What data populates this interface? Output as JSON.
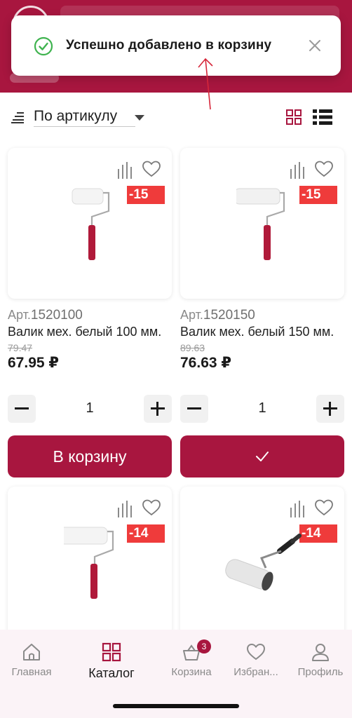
{
  "toast": {
    "message": "Успешно добавлено в корзину"
  },
  "sort": {
    "label": "По артикулу"
  },
  "colors": {
    "brand": "#a8163f",
    "discount": "#ef3b3b",
    "success": "#3fb34f"
  },
  "products": [
    {
      "sku_prefix": "Арт.",
      "sku": "1520100",
      "name": "Валик мех. белый 100 мм.",
      "old_price": "79.47",
      "price": "67.95 ₽",
      "discount": "-15",
      "qty": "1",
      "cart_label": "В корзину",
      "in_cart": false
    },
    {
      "sku_prefix": "Арт.",
      "sku": "1520150",
      "name": "Валик мех. белый 150 мм.",
      "old_price": "89.63",
      "price": "76.63 ₽",
      "discount": "-15",
      "qty": "1",
      "cart_label": "",
      "in_cart": true
    },
    {
      "discount": "-14"
    },
    {
      "discount": "-14"
    }
  ],
  "nav": {
    "items": [
      {
        "label": "Главная",
        "icon": "home-icon"
      },
      {
        "label": "Каталог",
        "icon": "catalog-grid-icon"
      },
      {
        "label": "Корзина",
        "icon": "basket-icon",
        "badge": "3"
      },
      {
        "label": "Избран...",
        "icon": "heart-icon"
      },
      {
        "label": "Профиль",
        "icon": "user-icon"
      }
    ]
  }
}
